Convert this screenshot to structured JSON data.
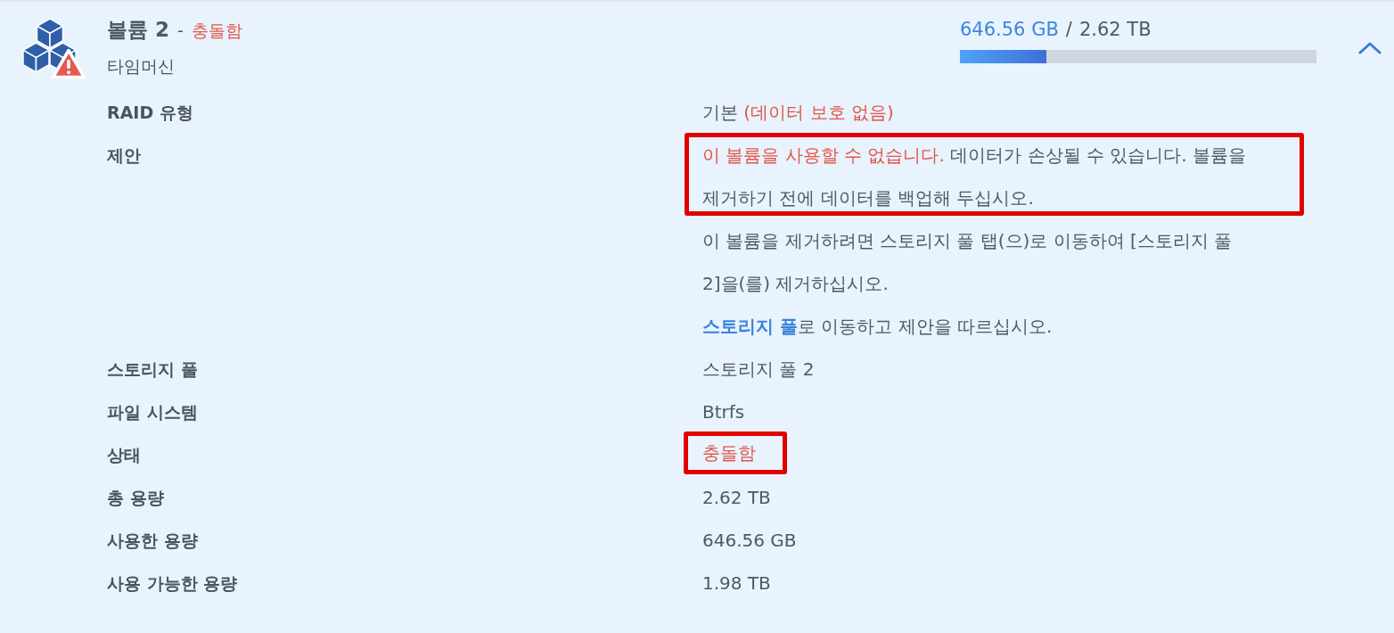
{
  "volume": {
    "name": "볼륨 2",
    "separator": "-",
    "status": "충돌함",
    "description": "타임머신",
    "expanded": true
  },
  "usage": {
    "used": "646.56 GB",
    "separator": "/",
    "total": "2.62 TB",
    "level": 0.243
  },
  "details": [
    {
      "kind": "text",
      "label": "RAID 유형",
      "highlighted": false,
      "segments": [
        {
          "text": "기본 "
        },
        {
          "warning": "(데이터 보호 없음)"
        }
      ]
    },
    {
      "kind": "suggestions",
      "label": "제안",
      "paragraphs": [
        {
          "highlighted": true,
          "segments": [
            {
              "warning": "이 볼륨을 사용할 수 없습니다."
            },
            {
              "text": " 데이터가 손상될 수 있습니다. 볼륨을 제거하기 전에 데이터를 백업해 두십시오."
            }
          ]
        },
        {
          "highlighted": false,
          "segments": [
            {
              "text": "이 볼륨을 제거하려면 스토리지 풀 탭(으)로 이동하여 [스토리지 풀 2]을(를) 제거하십시오."
            }
          ]
        },
        {
          "highlighted": false,
          "segments": [
            {
              "link": "스토리지 풀"
            },
            {
              "text": "로 이동하고 제안을 따르십시오."
            }
          ]
        }
      ]
    },
    {
      "kind": "text",
      "label": "스토리지 풀",
      "highlighted": false,
      "segments": [
        {
          "text": "스토리지 풀 2"
        }
      ]
    },
    {
      "kind": "text",
      "label": "파일 시스템",
      "highlighted": false,
      "segments": [
        {
          "text": "Btrfs"
        }
      ]
    },
    {
      "kind": "text",
      "label": "상태",
      "highlighted": true,
      "segments": [
        {
          "warning": "충돌함"
        }
      ]
    },
    {
      "kind": "text",
      "label": "총 용량",
      "highlighted": false,
      "segments": [
        {
          "text": "2.62 TB"
        }
      ]
    },
    {
      "kind": "text",
      "label": "사용한 용량",
      "highlighted": false,
      "segments": [
        {
          "text": "646.56 GB"
        }
      ]
    },
    {
      "kind": "text",
      "label": "사용 가능한 용량",
      "highlighted": false,
      "segments": [
        {
          "text": "1.98 TB"
        }
      ]
    }
  ]
}
